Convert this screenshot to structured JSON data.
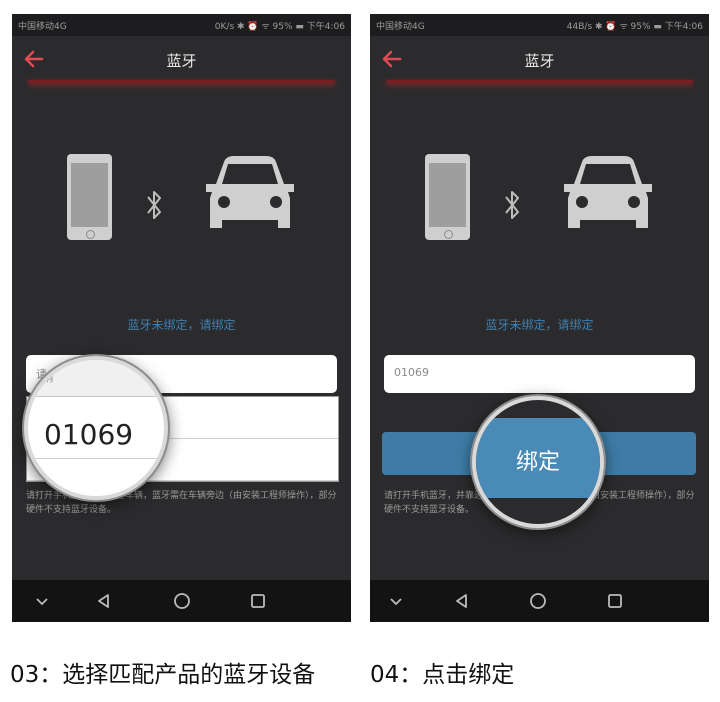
{
  "status_left": {
    "carrier": "中国移动4G",
    "right": "0K/s ✱ ⏰ ᯤ 95% ▬ 下午4:06"
  },
  "status_right": {
    "carrier": "中国移动4G",
    "right": "44B/s ✱ ⏰ ᯤ 95% ▬ 下午4:06"
  },
  "screen_left": {
    "title": "蓝牙",
    "hint": "蓝牙未绑定，请绑定",
    "input_placeholder": "请",
    "selected_option": "01069",
    "note": "请打开手机蓝牙，并靠近车辆，蓝牙需在车辆旁边（由安装工程师操作），部分硬件不支持蓝牙设备。"
  },
  "screen_right": {
    "title": "蓝牙",
    "hint": "蓝牙未绑定，请绑定",
    "input_value": "01069",
    "bind_label": "绑定",
    "note": "请打开手机蓝牙，并靠近车辆，蓝牙需在车辆旁边（由安装工程师操作），部分硬件不支持蓝牙设备。"
  },
  "captions": {
    "left": "03：选择匹配产品的蓝牙设备",
    "right": "04：点击绑定"
  },
  "colors": {
    "accent": "#3e7ca6",
    "back_arrow": "#e04a50",
    "background": "#2b2b2d"
  },
  "icons": [
    "back-arrow-icon",
    "phone-icon",
    "bluetooth-icon",
    "car-icon",
    "nav-back-icon",
    "nav-home-icon",
    "nav-recent-icon",
    "nav-down-icon"
  ]
}
